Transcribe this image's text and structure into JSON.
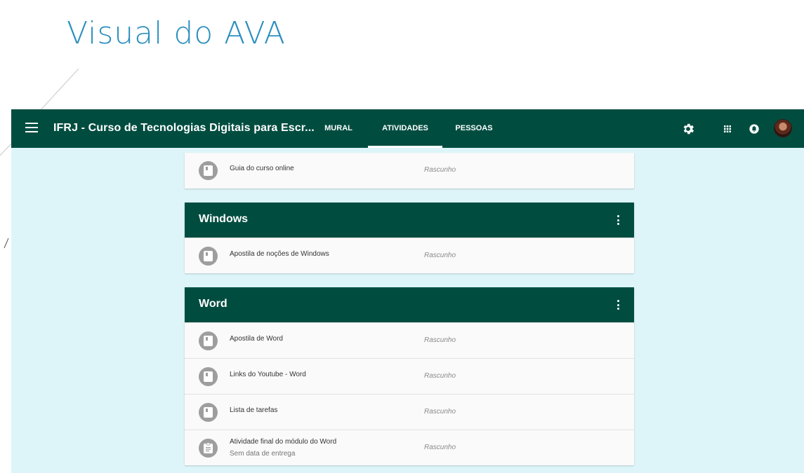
{
  "slide": {
    "title": "Visual do AVA"
  },
  "topbar": {
    "course_title": "IFRJ - Curso de Tecnologias Digitais para Escr...",
    "tabs": [
      {
        "label": "MURAL",
        "active": false
      },
      {
        "label": "ATIVIDADES",
        "active": true
      },
      {
        "label": "PESSOAS",
        "active": false
      }
    ],
    "icons": [
      "menu-icon",
      "gear-icon",
      "apps-grid-icon",
      "notification-icon",
      "avatar"
    ]
  },
  "colors": {
    "primary": "#004d40",
    "background": "#ddf5f8",
    "title": "#2a8fbf"
  },
  "loose_items": [
    {
      "title": "Guia do curso online",
      "status": "Rascunho",
      "icon": "material-icon"
    }
  ],
  "topics": [
    {
      "title": "Windows",
      "items": [
        {
          "title": "Apostila de noções de Windows",
          "status": "Rascunho",
          "icon": "material-icon"
        }
      ]
    },
    {
      "title": "Word",
      "items": [
        {
          "title": "Apostila de Word",
          "status": "Rascunho",
          "icon": "material-icon"
        },
        {
          "title": "Links do Youtube - Word",
          "status": "Rascunho",
          "icon": "material-icon"
        },
        {
          "title": "Lista de tarefas",
          "status": "Rascunho",
          "icon": "material-icon"
        },
        {
          "title": "Atividade final do módulo do Word",
          "subtitle": "Sem data de entrega",
          "status": "Rascunho",
          "icon": "assignment-icon"
        }
      ]
    }
  ]
}
